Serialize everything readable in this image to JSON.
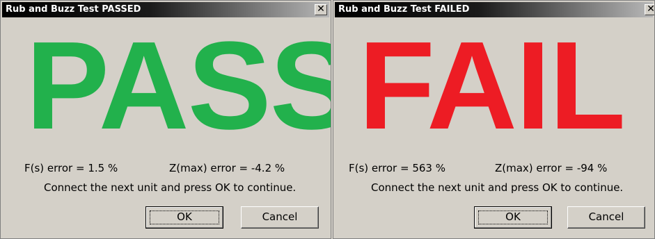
{
  "pass_dialog": {
    "title": "Rub and Buzz Test PASSED",
    "close_glyph": "✕",
    "result_word": "PASS",
    "fs_error": "F(s) error = 1.5 %",
    "zmax_error": "Z(max) error = -4.2 %",
    "message": "Connect the next unit and press OK to continue.",
    "ok_label": "OK",
    "cancel_label": "Cancel",
    "result_color": "#22b14c"
  },
  "fail_dialog": {
    "title": "Rub and Buzz Test FAILED",
    "close_glyph": "✕",
    "result_word": "FAIL",
    "fs_error": "F(s) error = 563 %",
    "zmax_error": "Z(max) error = -94 %",
    "message": "Connect the next unit and press OK to continue.",
    "ok_label": "OK",
    "cancel_label": "Cancel",
    "result_color": "#ed1c24"
  }
}
